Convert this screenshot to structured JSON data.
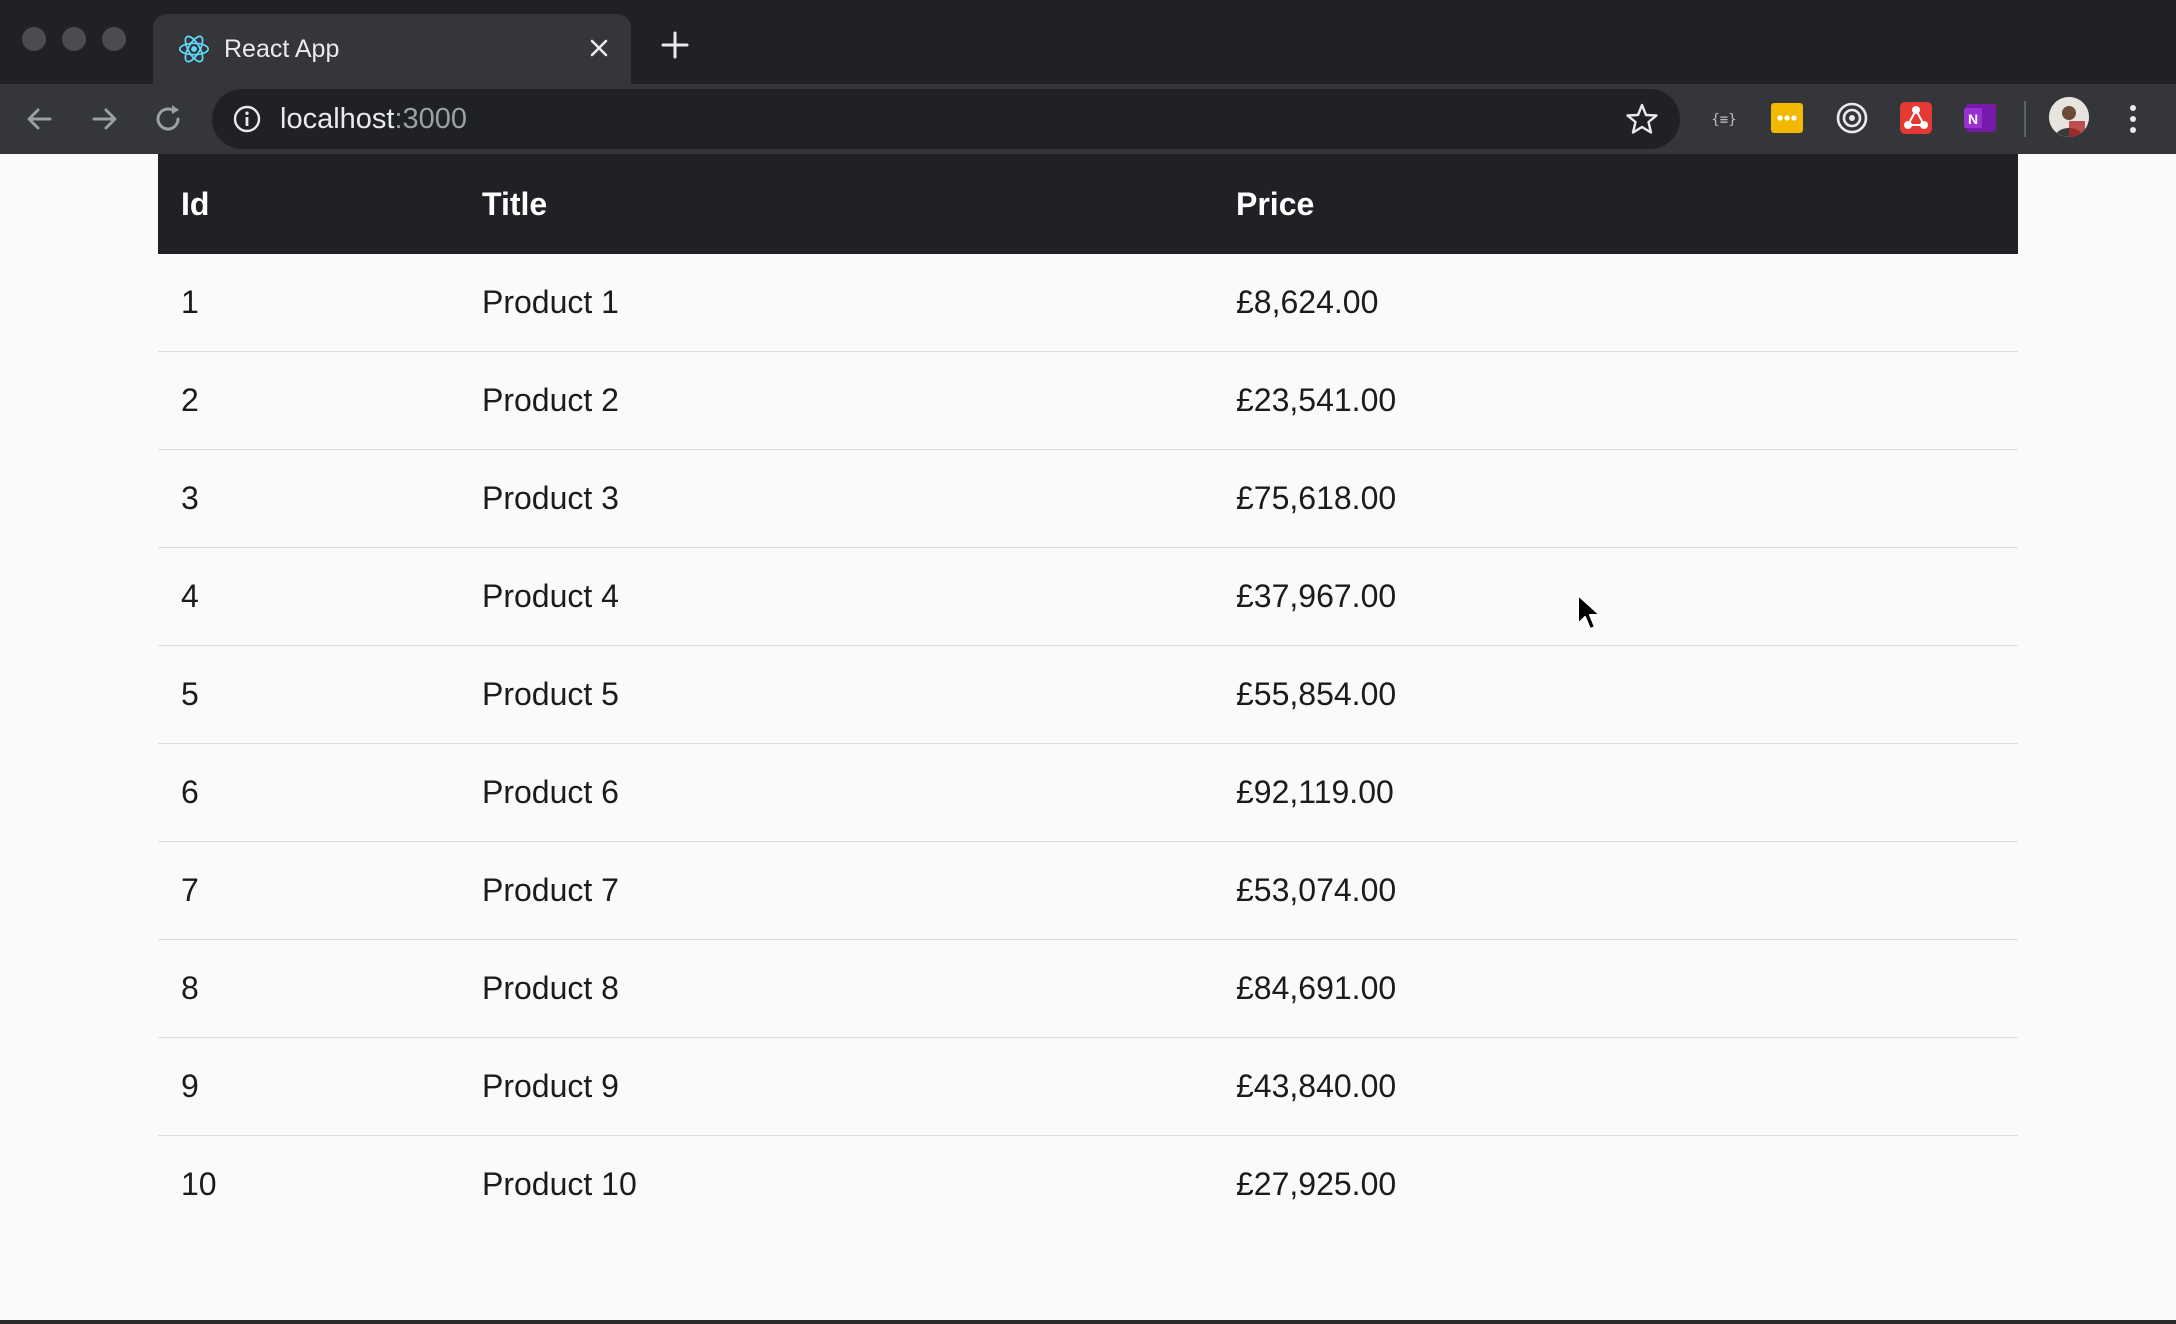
{
  "browser": {
    "tab_title": "React App",
    "url_host": "localhost",
    "url_port": ":3000",
    "icons": [
      "react-favicon-icon",
      "close-icon",
      "plus-icon",
      "back-arrow-icon",
      "forward-arrow-icon",
      "reload-icon",
      "info-icon",
      "star-icon",
      "json-viewer-extension-icon",
      "ellipsis-extension-icon",
      "target-extension-icon",
      "network-extension-icon",
      "onenote-extension-icon",
      "avatar",
      "more-vert-icon"
    ]
  },
  "table": {
    "headers": {
      "id": "Id",
      "title": "Title",
      "price": "Price"
    },
    "rows": [
      {
        "id": "1",
        "title": "Product 1",
        "price": "£8,624.00"
      },
      {
        "id": "2",
        "title": "Product 2",
        "price": "£23,541.00"
      },
      {
        "id": "3",
        "title": "Product 3",
        "price": "£75,618.00"
      },
      {
        "id": "4",
        "title": "Product 4",
        "price": "£37,967.00"
      },
      {
        "id": "5",
        "title": "Product 5",
        "price": "£55,854.00"
      },
      {
        "id": "6",
        "title": "Product 6",
        "price": "£92,119.00"
      },
      {
        "id": "7",
        "title": "Product 7",
        "price": "£53,074.00"
      },
      {
        "id": "8",
        "title": "Product 8",
        "price": "£84,691.00"
      },
      {
        "id": "9",
        "title": "Product 9",
        "price": "£43,840.00"
      },
      {
        "id": "10",
        "title": "Product 10",
        "price": "£27,925.00"
      }
    ]
  },
  "colors": {
    "chrome_dark": "#202124",
    "chrome_toolbar": "#35363a",
    "table_header_bg": "#1f2125",
    "page_bg": "#fafafa"
  }
}
